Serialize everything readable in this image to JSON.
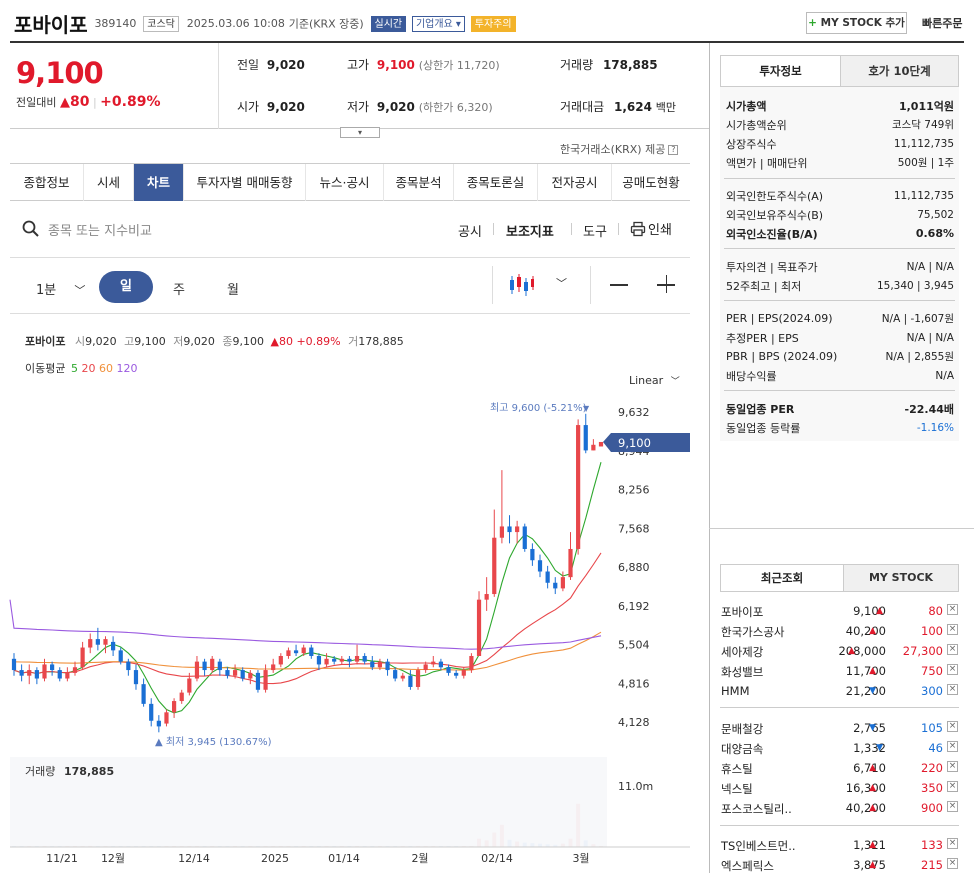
{
  "header": {
    "stock_name": "포바이포",
    "code": "389140",
    "market": "코스닥",
    "date": "2025.03.06 10:08",
    "basis": "기준(KRX 장중)",
    "badge_realtime": "실시간",
    "badge_company": "기업개요",
    "badge_warning": "투자주의",
    "my_stock_btn": "MY STOCK 추가",
    "quick_order": "빠른주문"
  },
  "price": {
    "current": "9,100",
    "change_label": "전일대비",
    "change": "80",
    "change_pct": "+0.89%",
    "prev_label": "전일",
    "prev": "9,020",
    "high_label": "고가",
    "high": "9,100",
    "upper_limit": "(상한가 11,720)",
    "volume_label": "거래량",
    "volume": "178,885",
    "open_label": "시가",
    "open": "9,020",
    "low_label": "저가",
    "low": "9,020",
    "lower_limit": "(하한가 6,320)",
    "amount_label": "거래대금",
    "amount": "1,624",
    "amount_unit": "백만",
    "provider": "한국거래소(KRX) 제공"
  },
  "tabs": [
    "종합정보",
    "시세",
    "차트",
    "투자자별 매매동향",
    "뉴스·공시",
    "종목분석",
    "종목토론실",
    "전자공시",
    "공매도현황"
  ],
  "toolbar": {
    "search_placeholder": "종목 또는 지수비교",
    "disclosure": "공시",
    "indicator": "보조지표",
    "tools": "도구",
    "print": "인쇄",
    "periods": [
      "1분",
      "일",
      "주",
      "월"
    ],
    "minus": "—",
    "plus": "+"
  },
  "chart_info": {
    "name": "포바이포",
    "open_l": "시",
    "open": "9,020",
    "high_l": "고",
    "high": "9,100",
    "low_l": "저",
    "low": "9,020",
    "close_l": "종",
    "close": "9,100",
    "chg": "▲80",
    "pct": "+0.89%",
    "vol_l": "거",
    "vol": "178,885",
    "ma_label": "이동평균",
    "ma": [
      "5",
      "20",
      "60",
      "120"
    ],
    "ma_colors": [
      "#2ea82e",
      "#e8474b",
      "#f0913c",
      "#9a5ae0"
    ],
    "scale": "Linear",
    "max_label": "최고 9,600 (-5.21%)",
    "min_label": "▲ 최저 3,945 (130.67%)",
    "price_tag": "9,100",
    "volume_title": "거래량",
    "volume_value": "178,885",
    "volume_axis": "11.0m"
  },
  "chart_data": {
    "type": "candlestick",
    "y_ticks": [
      "9,632",
      "8,944",
      "8,256",
      "7,568",
      "6,880",
      "6,192",
      "5,504",
      "4,816",
      "4,128"
    ],
    "x_ticks": [
      "11/21",
      "12월",
      "12/14",
      "2025",
      "01/14",
      "2월",
      "02/14",
      "3월"
    ],
    "ylim": [
      3800,
      9800
    ],
    "candles": [
      [
        5250,
        5050,
        5350,
        4950
      ],
      [
        5050,
        4950,
        5150,
        4850
      ],
      [
        4950,
        5050,
        5150,
        4800
      ],
      [
        5050,
        4900,
        5100,
        4800
      ],
      [
        4900,
        5150,
        5250,
        4850
      ],
      [
        5150,
        5050,
        5200,
        4950
      ],
      [
        5050,
        4900,
        5100,
        4850
      ],
      [
        4900,
        5000,
        5100,
        4850
      ],
      [
        5000,
        5100,
        5200,
        4950
      ],
      [
        5100,
        5450,
        5550,
        5050
      ],
      [
        5450,
        5600,
        5700,
        5350
      ],
      [
        5600,
        5500,
        5800,
        5400
      ],
      [
        5500,
        5600,
        5650,
        5350
      ],
      [
        5550,
        5400,
        5650,
        5300
      ],
      [
        5400,
        5200,
        5450,
        5150
      ],
      [
        5200,
        5050,
        5250,
        4950
      ],
      [
        5050,
        4800,
        5150,
        4700
      ],
      [
        4800,
        4450,
        4900,
        4400
      ],
      [
        4450,
        4150,
        4550,
        4050
      ],
      [
        4150,
        4050,
        4250,
        3945
      ],
      [
        4100,
        4300,
        4350,
        4050
      ],
      [
        4300,
        4500,
        4550,
        4200
      ],
      [
        4500,
        4650,
        4700,
        4450
      ],
      [
        4650,
        4900,
        5000,
        4600
      ],
      [
        4900,
        5200,
        5300,
        4850
      ],
      [
        5200,
        5050,
        5250,
        4950
      ],
      [
        5050,
        5250,
        5300,
        5000
      ],
      [
        5200,
        5050,
        5250,
        4950
      ],
      [
        5050,
        4950,
        5100,
        4900
      ],
      [
        4950,
        5050,
        5150,
        4900
      ],
      [
        5050,
        4900,
        5100,
        4850
      ],
      [
        4900,
        5000,
        5050,
        4800
      ],
      [
        5000,
        4700,
        5050,
        4650
      ],
      [
        4700,
        5050,
        5150,
        4650
      ],
      [
        5050,
        5150,
        5250,
        5000
      ],
      [
        5150,
        5300,
        5350,
        5100
      ],
      [
        5300,
        5400,
        5450,
        5250
      ],
      [
        5400,
        5350,
        5500,
        5300
      ],
      [
        5350,
        5450,
        5500,
        5300
      ],
      [
        5450,
        5300,
        5500,
        5250
      ],
      [
        5300,
        5150,
        5350,
        5050
      ],
      [
        5150,
        5250,
        5350,
        5100
      ],
      [
        5250,
        5200,
        5300,
        5150
      ],
      [
        5200,
        5250,
        5300,
        5150
      ],
      [
        5250,
        5200,
        5300,
        5100
      ],
      [
        5200,
        5300,
        5500,
        5150
      ],
      [
        5300,
        5200,
        5350,
        5150
      ],
      [
        5200,
        5100,
        5300,
        5050
      ],
      [
        5100,
        5200,
        5250,
        5050
      ],
      [
        5200,
        5050,
        5250,
        4950
      ],
      [
        5050,
        4900,
        5100,
        4850
      ],
      [
        4900,
        4950,
        5000,
        4850
      ],
      [
        4950,
        4750,
        5050,
        4700
      ],
      [
        4750,
        5050,
        5100,
        4700
      ],
      [
        5050,
        5150,
        5200,
        5000
      ],
      [
        5150,
        5200,
        5300,
        5100
      ],
      [
        5200,
        5100,
        5250,
        5050
      ],
      [
        5100,
        5000,
        5150,
        4950
      ],
      [
        5000,
        4950,
        5050,
        4900
      ],
      [
        4950,
        5050,
        5100,
        4900
      ],
      [
        5050,
        5300,
        5350,
        5000
      ],
      [
        5300,
        6300,
        6450,
        5800
      ],
      [
        6300,
        6400,
        6700,
        6100
      ],
      [
        6400,
        7400,
        7900,
        6350
      ],
      [
        7400,
        7600,
        8600,
        7300
      ],
      [
        7600,
        7500,
        7800,
        7300
      ],
      [
        7500,
        7600,
        7700,
        7300
      ],
      [
        7600,
        7200,
        7650,
        7150
      ],
      [
        7200,
        7000,
        7300,
        6900
      ],
      [
        7000,
        6800,
        7100,
        6700
      ],
      [
        6800,
        6600,
        6900,
        6500
      ],
      [
        6600,
        6500,
        6700,
        6400
      ],
      [
        6500,
        6700,
        6800,
        6450
      ],
      [
        6700,
        7200,
        7500,
        6650
      ],
      [
        7200,
        9400,
        9500,
        7100
      ],
      [
        9400,
        8950,
        9600,
        8900
      ],
      [
        8950,
        9050,
        9150,
        8950
      ],
      [
        9020,
        9100,
        9100,
        9020
      ]
    ],
    "volume_max": 11000000,
    "volumes": [
      80,
      60,
      50,
      70,
      90,
      60,
      50,
      40,
      60,
      150,
      200,
      120,
      100,
      90,
      80,
      70,
      90,
      110,
      130,
      160,
      120,
      100,
      110,
      140,
      180,
      90,
      110,
      80,
      60,
      70,
      60,
      50,
      80,
      120,
      100,
      110,
      120,
      90,
      100,
      80,
      60,
      70,
      60,
      50,
      60,
      120,
      60,
      50,
      60,
      80,
      60,
      50,
      90,
      120,
      100,
      80,
      60,
      50,
      40,
      50,
      90,
      1500,
      1200,
      2600,
      4000,
      1300,
      1000,
      800,
      700,
      600,
      500,
      400,
      600,
      1500,
      7800,
      1200,
      500,
      150
    ]
  },
  "right_panel": {
    "tabs": [
      "투자정보",
      "호가 10단계"
    ],
    "rows1": [
      {
        "label": "시가총액",
        "value": "1,011억원",
        "bold": true
      },
      {
        "label": "시가총액순위",
        "value": "코스닥 749위"
      },
      {
        "label": "상장주식수",
        "value": "11,112,735"
      },
      {
        "label": "액면가 | 매매단위",
        "value": "500원 | 1주"
      }
    ],
    "rows2": [
      {
        "label": "외국인한도주식수(A)",
        "value": "11,112,735"
      },
      {
        "label": "외국인보유주식수(B)",
        "value": "75,502"
      },
      {
        "label": "외국인소진율(B/A)",
        "value": "0.68%",
        "bold": true
      }
    ],
    "rows3": [
      {
        "label": "투자의견 | 목표주가",
        "value": "N/A | N/A"
      },
      {
        "label": "52주최고 | 최저",
        "value": "15,340 | 3,945"
      }
    ],
    "rows4": [
      {
        "label": "PER | EPS(2024.09)",
        "value": "N/A | -1,607원"
      },
      {
        "label": "추정PER | EPS",
        "value": "N/A | N/A"
      },
      {
        "label": "PBR | BPS (2024.09)",
        "value": "N/A | 2,855원"
      },
      {
        "label": "배당수익률",
        "value": "N/A"
      }
    ],
    "rows5": [
      {
        "label": "동일업종 PER",
        "value": "-22.44배",
        "bold": true
      },
      {
        "label": "동일업종 등락률",
        "value": "-1.16%",
        "blue": true
      }
    ],
    "recent_tabs": [
      "최근조회",
      "MY STOCK"
    ],
    "recent": [
      {
        "name": "포바이포",
        "price": "9,100",
        "chg": "80",
        "dir": "up"
      },
      {
        "name": "한국가스공사",
        "price": "40,200",
        "chg": "100",
        "dir": "up"
      },
      {
        "name": "세아제강",
        "price": "208,000",
        "chg": "27,300",
        "dir": "up"
      },
      {
        "name": "화성밸브",
        "price": "11,700",
        "chg": "750",
        "dir": "up"
      },
      {
        "name": "HMM",
        "price": "21,200",
        "chg": "300",
        "dir": "dn"
      }
    ],
    "recent2": [
      {
        "name": "문배철강",
        "price": "2,765",
        "chg": "105",
        "dir": "dn"
      },
      {
        "name": "대양금속",
        "price": "1,332",
        "chg": "46",
        "dir": "dn"
      },
      {
        "name": "휴스틸",
        "price": "6,710",
        "chg": "220",
        "dir": "up"
      },
      {
        "name": "넥스틸",
        "price": "16,300",
        "chg": "350",
        "dir": "up"
      },
      {
        "name": "포스코스틸리..",
        "price": "40,200",
        "chg": "900",
        "dir": "up"
      }
    ],
    "recent3": [
      {
        "name": "TS인베스트먼..",
        "price": "1,321",
        "chg": "133",
        "dir": "up"
      },
      {
        "name": "엑스페릭스",
        "price": "3,875",
        "chg": "215",
        "dir": "up"
      }
    ]
  }
}
